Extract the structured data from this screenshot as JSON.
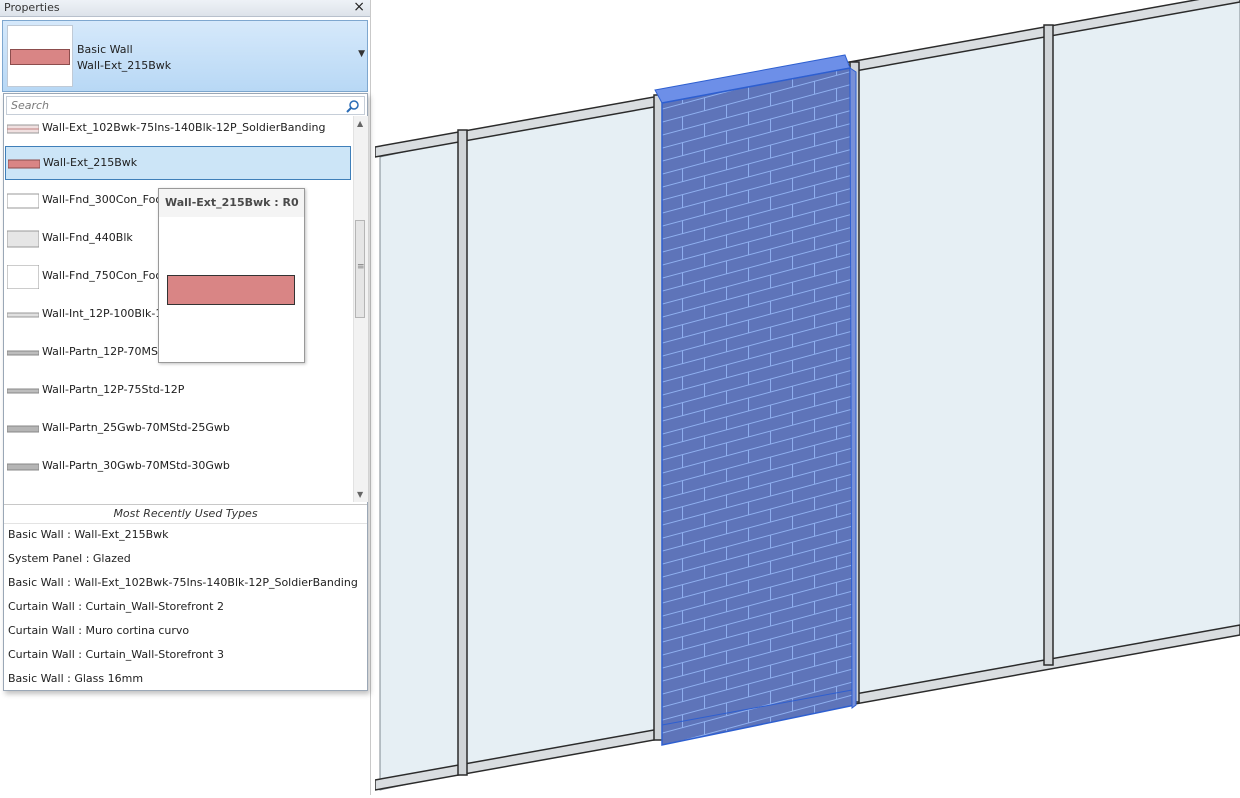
{
  "palette": {
    "wall_ext_swatch": "#d98585",
    "selection_bg": "#cce5f7",
    "selection_border": "#3f7fb9",
    "selected_element": "#2e5fd0",
    "glass": "#e6eff4",
    "mullion": "#2b2b2b"
  },
  "properties": {
    "title": "Properties",
    "close_icon": "close-icon",
    "type_selector": {
      "family": "Basic Wall",
      "type": "Wall-Ext_215Bwk",
      "dropdown_icon": "dropdown-arrow-icon"
    },
    "dropdown": {
      "search_placeholder": "Search",
      "search_icon": "search-icon",
      "items": [
        {
          "label": "Wall-Ext_102Bwk-75Ins-140Blk-12P_SoldierBanding"
        },
        {
          "label": "Wall-Ext_215Bwk"
        },
        {
          "label": "Wall-Fnd_300Con_Foo"
        },
        {
          "label": "Wall-Fnd_440Blk"
        },
        {
          "label": "Wall-Fnd_750Con_Foo"
        },
        {
          "label": "Wall-Int_12P-100Blk-1"
        },
        {
          "label": "Wall-Partn_12P-70MS"
        },
        {
          "label": "Wall-Partn_12P-75Std-12P"
        },
        {
          "label": "Wall-Partn_25Gwb-70MStd-25Gwb"
        },
        {
          "label": "Wall-Partn_30Gwb-70MStd-30Gwb"
        }
      ],
      "selected_label": "Wall-Ext_215Bwk",
      "mru_header": "Most Recently Used Types",
      "mru": [
        "Basic Wall : Wall-Ext_215Bwk",
        "System Panel : Glazed",
        "Basic Wall : Wall-Ext_102Bwk-75Ins-140Blk-12P_SoldierBanding",
        "Curtain Wall : Curtain_Wall-Storefront 2",
        "Curtain Wall : Muro cortina curvo",
        "Curtain Wall : Curtain_Wall-Storefront 3",
        "Basic Wall : Glass 16mm"
      ]
    },
    "tooltip": {
      "title": "Wall-Ext_215Bwk : R0"
    }
  }
}
